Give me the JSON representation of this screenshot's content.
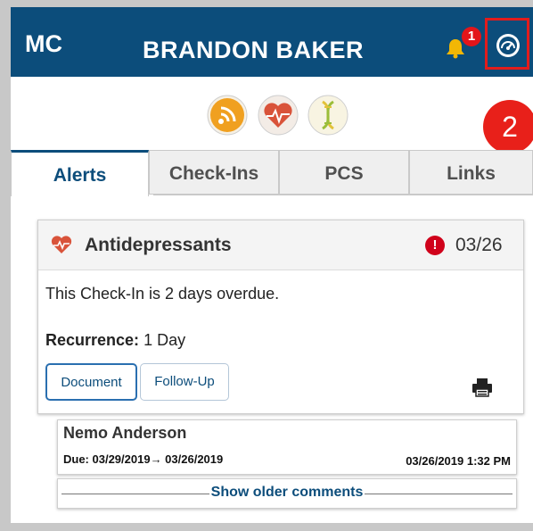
{
  "header": {
    "logo": "MC",
    "patient_name": "BRANDON BAKER",
    "notification_count": "1",
    "bell_icon": "bell-icon",
    "dashboard_icon": "dashboard-gauge-icon",
    "accent_color": "#0c4d7b"
  },
  "topics": [
    {
      "icon": "signal-waves-icon",
      "color": "#f0a020"
    },
    {
      "icon": "heart-pulse-icon",
      "color": "#d9533a"
    },
    {
      "icon": "dna-icon",
      "color": "#e2c23a"
    }
  ],
  "step_marker": "2",
  "tabs": [
    {
      "label": "Alerts",
      "active": true
    },
    {
      "label": "Check-Ins",
      "active": false
    },
    {
      "label": "PCS",
      "active": false
    },
    {
      "label": "Links",
      "active": false
    }
  ],
  "alert_card": {
    "icon": "heart-pulse-icon",
    "title": "Antidepressants",
    "status_icon": "exclamation-icon",
    "date": "03/26",
    "message": "This Check-In is 2 days overdue.",
    "recurrence_label": "Recurrence:",
    "recurrence_value": "1 Day",
    "document_button": "Document",
    "followup_button": "Follow-Up",
    "print_icon": "printer-icon"
  },
  "comment": {
    "author": "Nemo Anderson",
    "due_text": "Due: 03/29/2019→ 03/26/2019",
    "timestamp": "03/26/2019 1:32 PM"
  },
  "show_older_label": "Show older comments"
}
